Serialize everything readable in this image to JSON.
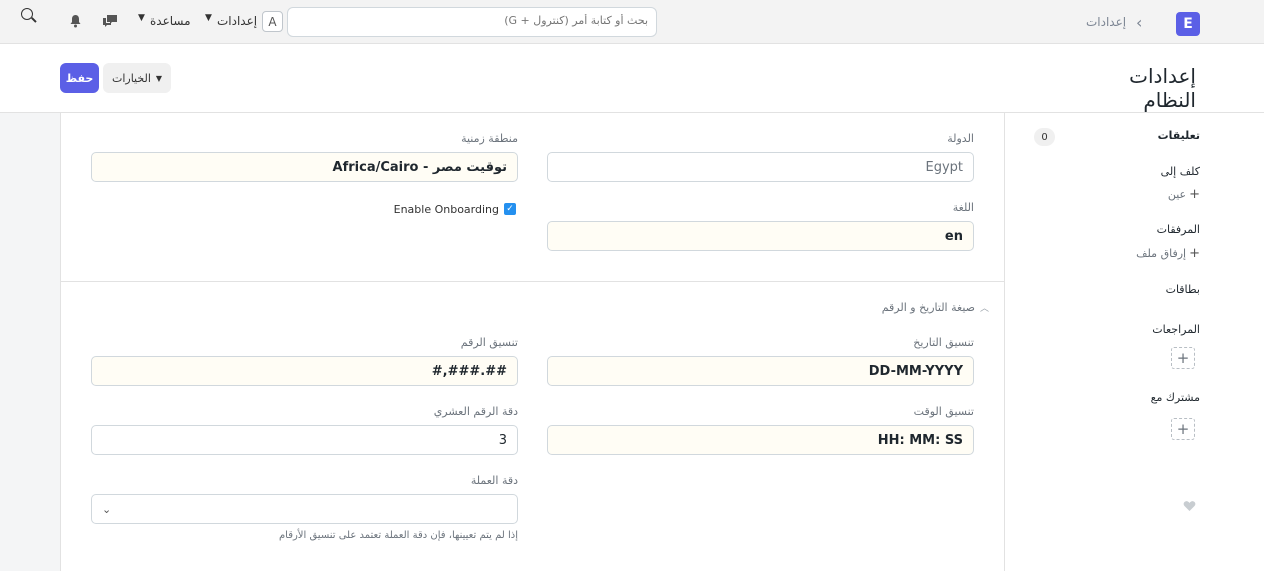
{
  "navbar": {
    "logo_letter": "E",
    "breadcrumb": "إعدادات",
    "search_placeholder": "بحث أو كتابة أمر (كنترول + G)",
    "avatar_letter": "A",
    "settings_label": "إعدادات",
    "help_label": "مساعدة"
  },
  "page": {
    "title": "إعدادات النظام",
    "save_label": "حفظ",
    "options_label": "الخيارات"
  },
  "form": {
    "country_label": "الدولة",
    "country_value": "Egypt",
    "timezone_label": "منطقة زمنية",
    "timezone_value": "توقيت مصر - Africa/Cairo",
    "language_label": "اللغة",
    "language_value": "en",
    "onboarding_label": "Enable Onboarding",
    "onboarding_checked": true,
    "section_title": "صيغة التاريخ و الرقم",
    "date_format_label": "تنسيق التاريخ",
    "date_format_value": "DD-MM-YYYY",
    "number_format_label": "تنسيق الرقم",
    "number_format_value": "#,###.##",
    "time_format_label": "تنسيق الوقت",
    "time_format_value": "HH: MM: SS",
    "float_precision_label": "دقة الرقم العشري",
    "float_precision_value": "3",
    "currency_precision_label": "دقة العملة",
    "currency_precision_value": "",
    "currency_precision_help": "إذا لم يتم تعيينها، فإن دقة العملة تعتمد على تنسيق الأرقام"
  },
  "sidebar": {
    "comments_label": "تعليقات",
    "comments_count": "0",
    "assigned_label": "كلف إلى",
    "assign_link": "عين",
    "attachments_label": "المرفقات",
    "attach_link": "إرفاق ملف",
    "tags_label": "بطاقات",
    "reviews_label": "المراجعات",
    "shared_label": "مشترك مع"
  },
  "colors": {
    "primary": "#5b5fe6",
    "field_bg": "#fffdf5",
    "check": "#2490ef"
  }
}
